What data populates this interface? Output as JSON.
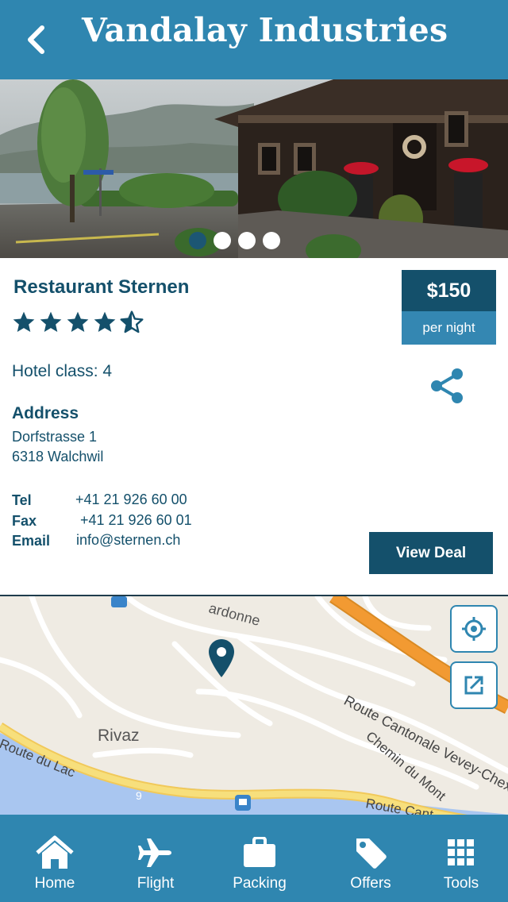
{
  "header": {
    "title": "Vandalay Industries"
  },
  "gallery": {
    "slide_count": 4,
    "active_index": 0
  },
  "listing": {
    "name": "Restaurant Sternen",
    "rating": 4.5,
    "rating_max": 5,
    "price": "$150",
    "price_unit": "per night",
    "hotel_class": "Hotel class: 4"
  },
  "address": {
    "heading": "Address",
    "line1": "Dorfstrasse 1",
    "line2": "6318 Walchwil"
  },
  "contact": {
    "tel_label": "Tel",
    "tel": "+41 21 926 60 00",
    "fax_label": "Fax",
    "fax": "+41 21 926 60 01",
    "email_label": "Email",
    "email": "info@sternen.ch"
  },
  "actions": {
    "view_deal": "View Deal"
  },
  "map": {
    "labels": {
      "rivaz": "Rivaz",
      "route_cantonale": "Route Cantonale Vevey-Chexbres",
      "chemin_du_mont": "Chemin du Mont",
      "route_du_lac": "Route du Lac",
      "route_cant": "Route Cant",
      "cardonne": "ardonne",
      "road_number": "9"
    }
  },
  "tabs": [
    {
      "label": "Home",
      "icon": "home-icon"
    },
    {
      "label": "Flight",
      "icon": "airplane-icon"
    },
    {
      "label": "Packing",
      "icon": "briefcase-icon"
    },
    {
      "label": "Offers",
      "icon": "tag-icon"
    },
    {
      "label": "Tools",
      "icon": "grid-icon"
    }
  ],
  "colors": {
    "header": "#2f86b0",
    "primary_dark": "#14506b",
    "accent": "#3487b2",
    "map_land": "#efebe3",
    "map_water": "#a9c6f0",
    "map_highway": "#f29a32",
    "map_main_road": "#f7df7c"
  }
}
